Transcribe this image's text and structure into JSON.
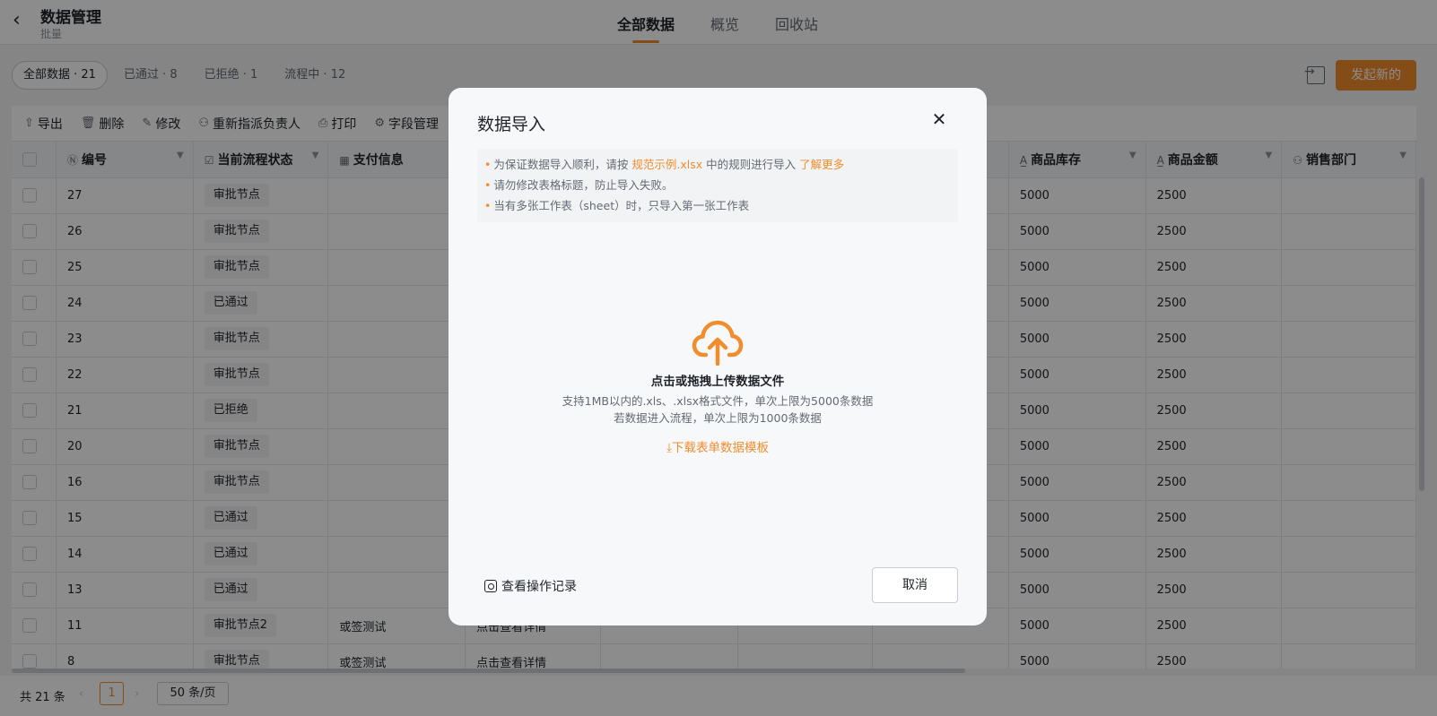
{
  "header": {
    "title": "数据管理",
    "subtitle": "批量",
    "tabs": [
      {
        "label": "全部数据"
      },
      {
        "label": "概览"
      },
      {
        "label": "回收站"
      }
    ]
  },
  "filters": [
    {
      "label": "全部数据 · 21"
    },
    {
      "label": "已通过 · 8"
    },
    {
      "label": "已拒绝 · 1"
    },
    {
      "label": "流程中 · 12"
    }
  ],
  "actions": {
    "start_label": "发起新的"
  },
  "toolbar": {
    "export": "导出",
    "delete": "删除",
    "edit": "修改",
    "reassign": "重新指派负责人",
    "print": "打印",
    "fields": "字段管理"
  },
  "table": {
    "columns": {
      "id": "编号",
      "status": "当前流程状态",
      "payment": "支付信息",
      "stock": "商品库存",
      "amount": "商品金额",
      "dept": "销售部门"
    },
    "rows": [
      {
        "id": "27",
        "status": "审批节点",
        "c3": "",
        "c4": "",
        "stock": "5000",
        "amount": "2500"
      },
      {
        "id": "26",
        "status": "审批节点",
        "c3": "",
        "c4": "",
        "stock": "5000",
        "amount": "2500"
      },
      {
        "id": "25",
        "status": "审批节点",
        "c3": "",
        "c4": "",
        "stock": "5000",
        "amount": "2500"
      },
      {
        "id": "24",
        "status": "已通过",
        "c3": "",
        "c4": "",
        "stock": "5000",
        "amount": "2500"
      },
      {
        "id": "23",
        "status": "审批节点",
        "c3": "",
        "c4": "",
        "stock": "5000",
        "amount": "2500"
      },
      {
        "id": "22",
        "status": "审批节点",
        "c3": "",
        "c4": "",
        "stock": "5000",
        "amount": "2500"
      },
      {
        "id": "21",
        "status": "已拒绝",
        "c3": "",
        "c4": "",
        "stock": "5000",
        "amount": "2500"
      },
      {
        "id": "20",
        "status": "审批节点",
        "c3": "",
        "c4": "",
        "stock": "5000",
        "amount": "2500"
      },
      {
        "id": "16",
        "status": "审批节点",
        "c3": "",
        "c4": "",
        "stock": "5000",
        "amount": "2500"
      },
      {
        "id": "15",
        "status": "已通过",
        "c3": "",
        "c4": "",
        "stock": "5000",
        "amount": "2500"
      },
      {
        "id": "14",
        "status": "已通过",
        "c3": "",
        "c4": "",
        "stock": "5000",
        "amount": "2500"
      },
      {
        "id": "13",
        "status": "已通过",
        "c3": "",
        "c4": "",
        "stock": "5000",
        "amount": "2500"
      },
      {
        "id": "11",
        "status": "审批节点2",
        "c3": "或签测试",
        "c4": "点击查看详情",
        "stock": "5000",
        "amount": "2500"
      },
      {
        "id": "8",
        "status": "审批节点",
        "c3": "或签测试",
        "c4": "点击查看详情",
        "stock": "5000",
        "amount": "2500"
      }
    ]
  },
  "pagination": {
    "total": "共 21 条",
    "prev": "‹",
    "current": "1",
    "next": "›",
    "page_size": "50 条/页"
  },
  "modal": {
    "title": "数据导入",
    "notice": {
      "line1_pre": "为保证数据导入顺利，请按",
      "line1_link": "规范示例.xlsx",
      "line1_post": "中的规则进行导入",
      "line1_more": "了解更多",
      "line2": "请勿修改表格标题，防止导入失败。",
      "line3": "当有多张工作表（sheet）时，只导入第一张工作表"
    },
    "upload": {
      "title": "点击或拖拽上传数据文件",
      "desc1": "支持1MB以内的.xls、.xlsx格式文件，单次上限为5000条数据",
      "desc2": "若数据进入流程，单次上限为1000条数据",
      "download": "下载表单数据模板"
    },
    "ops_label": "查看操作记录",
    "cancel_label": "取消"
  },
  "colors": {
    "accent": "#f08d2d",
    "overlay": "rgba(0,0,0,0.45)"
  },
  "icons": [
    "back-icon",
    "exit-icon",
    "export-icon",
    "delete-icon",
    "edit-icon",
    "user-icon",
    "print-icon",
    "settings-icon",
    "close-icon",
    "cloud-upload-icon",
    "download-icon",
    "log-icon"
  ]
}
